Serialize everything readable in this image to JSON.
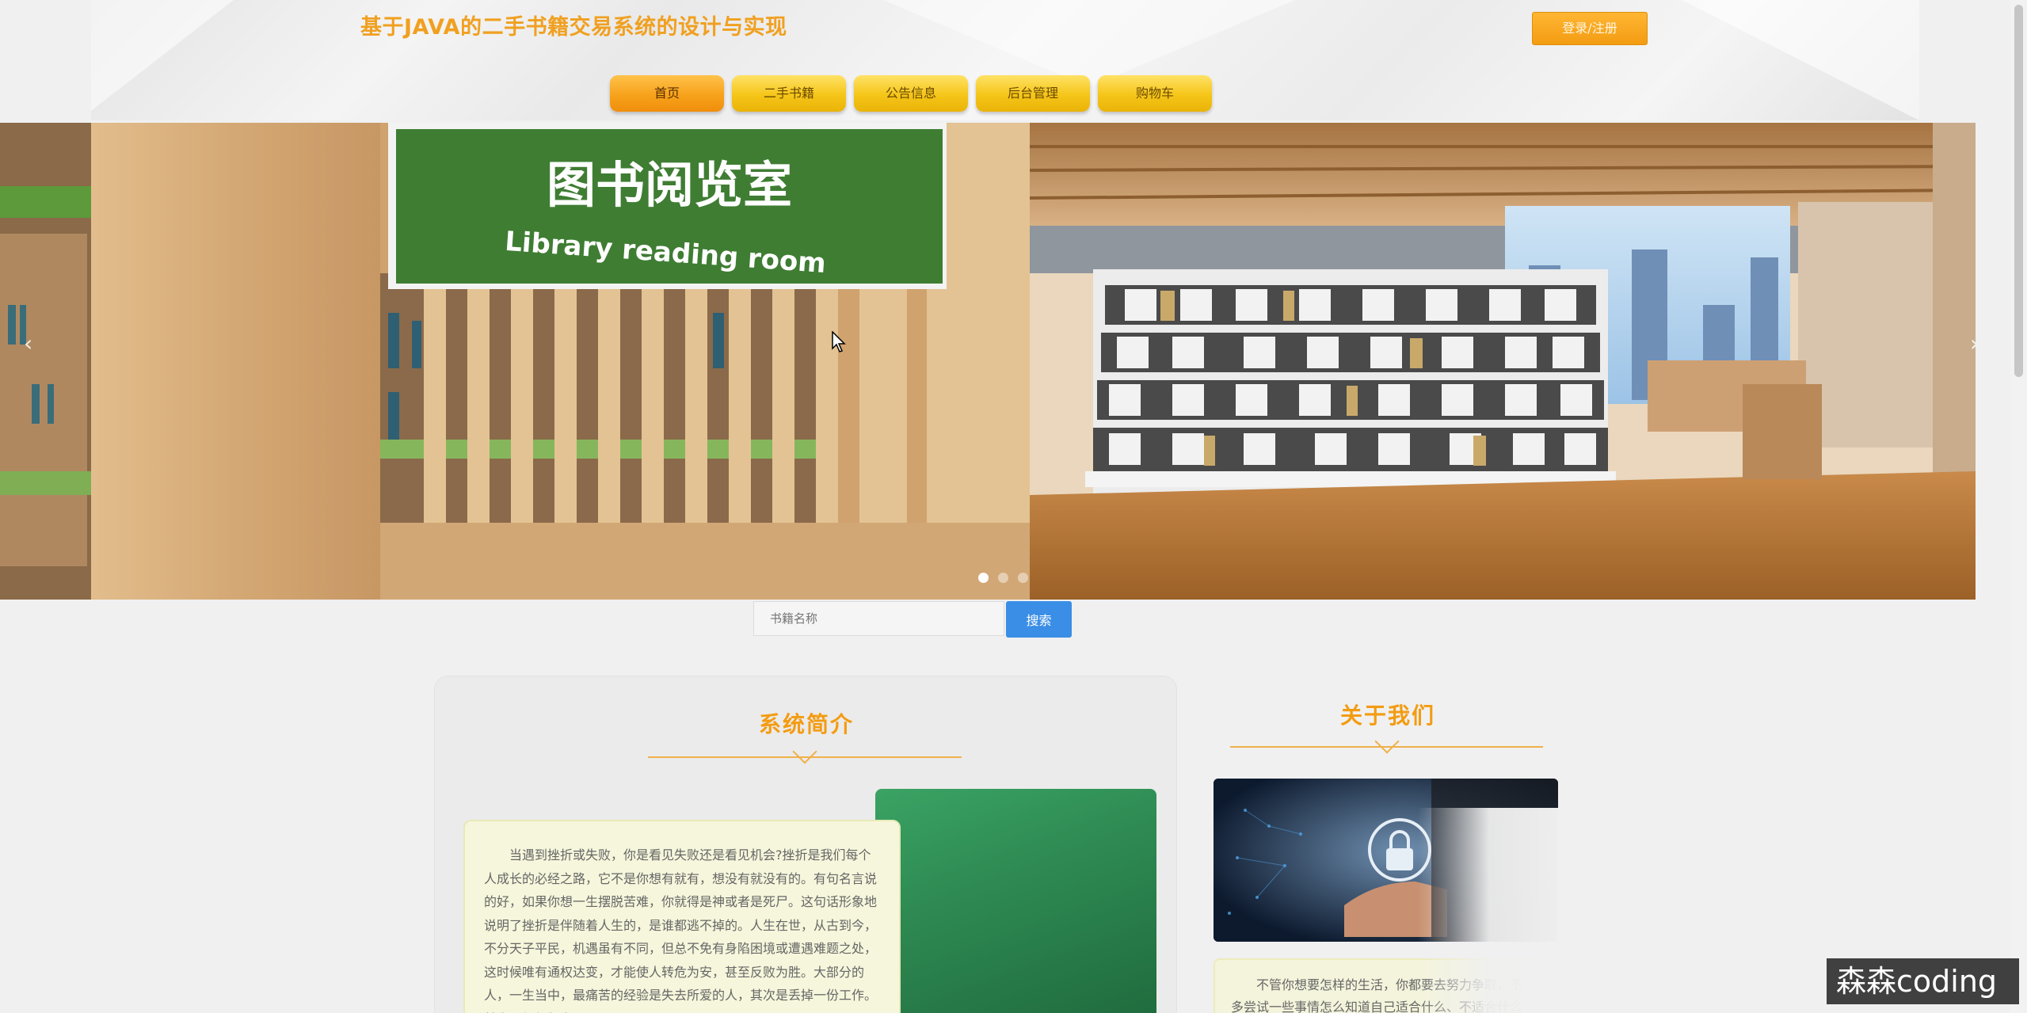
{
  "header": {
    "site_title": "基于JAVA的二手书籍交易系统的设计与实现",
    "login_label": "登录/注册"
  },
  "nav": {
    "items": [
      {
        "label": "首页",
        "active": true
      },
      {
        "label": "二手书籍",
        "active": false
      },
      {
        "label": "公告信息",
        "active": false
      },
      {
        "label": "后台管理",
        "active": false
      },
      {
        "label": "购物车",
        "active": false
      }
    ]
  },
  "banner": {
    "sign_cn": "图书阅览室",
    "sign_en": "Library reading room",
    "slide_count": 3,
    "active_slide": 1
  },
  "search": {
    "placeholder": "书籍名称",
    "button_label": "搜索"
  },
  "intro": {
    "title": "系统简介",
    "text": "当遇到挫折或失败，你是看见失败还是看见机会?挫折是我们每个人成长的必经之路，它不是你想有就有，想没有就没有的。有句名言说的好，如果你想一生摆脱苦难，你就得是神或者是死尸。这句话形象地说明了挫折是伴随着人生的，是谁都逃不掉的。人生在世，从古到今，不分天子平民，机遇虽有不同，但总不免有身陷困境或遭遇难题之处，这时候唯有通权达变，才能使人转危为安，甚至反败为胜。大部分的人，一生当中，最痛苦的经验是失去所爱的人，其次是丢掉一份工作。其实，经得起考"
  },
  "about": {
    "title": "关于我们",
    "text": "不管你想要怎样的生活，你都要去努力争取，不多尝试一些事情怎么知道自己适合什么、不适合什么呢?"
  },
  "watermark": "森森coding",
  "colors": {
    "accent": "#f39c12",
    "nav_yellow": "#f5c518",
    "search_blue": "#3a8ee6"
  }
}
